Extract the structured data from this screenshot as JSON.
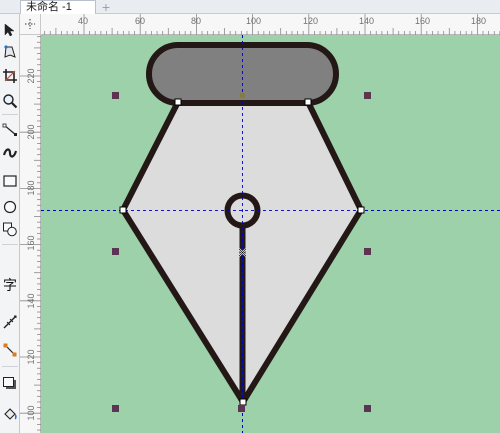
{
  "document": {
    "tab_label": "未命名 -1",
    "add_tab_label": "+"
  },
  "toolbox": {
    "tools": [
      {
        "name": "pick-tool-icon"
      },
      {
        "name": "shape-tool-icon"
      },
      {
        "name": "crop-tool-icon"
      },
      {
        "name": "zoom-tool-icon"
      },
      {
        "name": "freehand-tool-icon"
      },
      {
        "name": "artistic-media-tool-icon"
      },
      {
        "name": "rectangle-tool-icon"
      },
      {
        "name": "ellipse-tool-icon"
      },
      {
        "name": "polygon-tool-icon"
      },
      {
        "name": "text-tool-icon"
      },
      {
        "name": "parallel-dimension-tool-icon"
      },
      {
        "name": "connector-tool-icon"
      },
      {
        "name": "drop-shadow-tool-icon"
      },
      {
        "name": "fill-tool-icon"
      }
    ],
    "text_tool_glyph": "字"
  },
  "rulers": {
    "horizontal_labels": [
      "40",
      "60",
      "80",
      "100",
      "120",
      "140",
      "160",
      "180"
    ],
    "vertical_labels": [
      "220",
      "200",
      "180",
      "160",
      "140",
      "120",
      "100"
    ]
  },
  "colors": {
    "canvas_background": "#9dd1aa",
    "nib_fill": "#dcdcdc",
    "cap_fill": "#808080",
    "outline": "#231815",
    "guideline": "#0000cc",
    "selection_handle": "#5b3553"
  }
}
